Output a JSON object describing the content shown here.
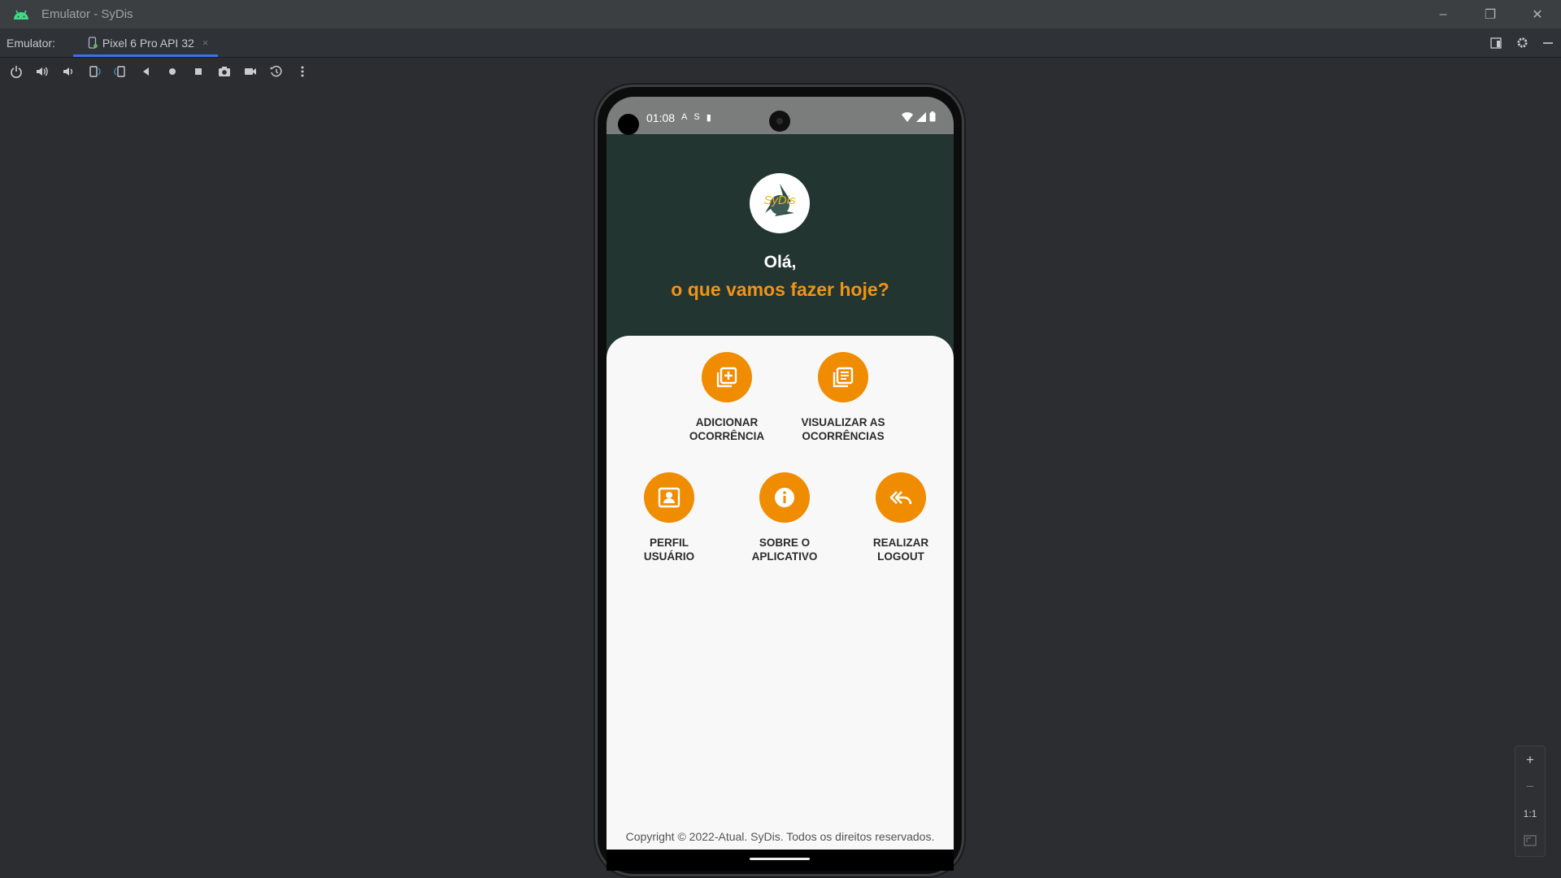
{
  "window": {
    "title": "Emulator - SyDis",
    "minimize_glyph": "–",
    "maximize_glyph": "❐",
    "close_glyph": "✕"
  },
  "tabbar": {
    "label": "Emulator:",
    "tab_label": "Pixel 6 Pro API 32",
    "tab_close": "×"
  },
  "toolbar": {
    "icons": [
      "power-icon",
      "volume-up-icon",
      "volume-down-icon",
      "rotate-left-icon",
      "rotate-right-icon",
      "back-icon",
      "home-icon",
      "overview-icon",
      "screenshot-icon",
      "screen-record-icon",
      "snapshot-icon",
      "more-icon"
    ]
  },
  "device": {
    "status_time": "01:08",
    "status_icons": [
      "A",
      "S",
      "▮"
    ],
    "app": {
      "logo_text": "SyDis",
      "greeting": "Olá,",
      "subtitle": "o que vamos fazer hoje?",
      "actions": [
        {
          "line1": "ADICIONAR",
          "line2": "OCORRÊNCIA",
          "icon": "add-note-icon"
        },
        {
          "line1": "VISUALIZAR AS",
          "line2": "OCORRÊNCIAS",
          "icon": "list-icon"
        },
        {
          "line1": "PERFIL",
          "line2": "USUÁRIO",
          "icon": "profile-icon"
        },
        {
          "line1": "SOBRE O",
          "line2": "APLICATIVO",
          "icon": "info-icon"
        },
        {
          "line1": "REALIZAR",
          "line2": "LOGOUT",
          "icon": "logout-icon"
        }
      ],
      "copyright": "Copyright © 2022-Atual. SyDis. Todos os direitos reservados."
    }
  },
  "zoom": {
    "zoom_in": "+",
    "zoom_out": "−",
    "one_to_one": "1:1"
  },
  "colors": {
    "accent_orange": "#f08c00",
    "header_green": "#233531",
    "tab_underline": "#3574f0"
  }
}
